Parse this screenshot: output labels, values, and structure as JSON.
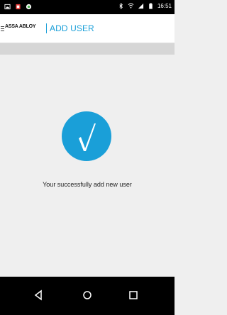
{
  "status_bar": {
    "time": "16:51",
    "left_icons": [
      "image-icon",
      "notification-icon",
      "browser-icon"
    ],
    "right_icons": [
      "bluetooth-icon",
      "wifi-icon",
      "signal-icon",
      "battery-icon"
    ]
  },
  "app_bar": {
    "brand": "ASSA ABLOY",
    "title": "ADD USER"
  },
  "content": {
    "icon": "checkmark-icon",
    "message": "Your successfully add new user"
  },
  "nav_bar": {
    "buttons": [
      "back-icon",
      "home-icon",
      "recents-icon"
    ]
  },
  "colors": {
    "accent": "#1a9fd8",
    "background": "#efefef",
    "band": "#d6d6d6"
  }
}
